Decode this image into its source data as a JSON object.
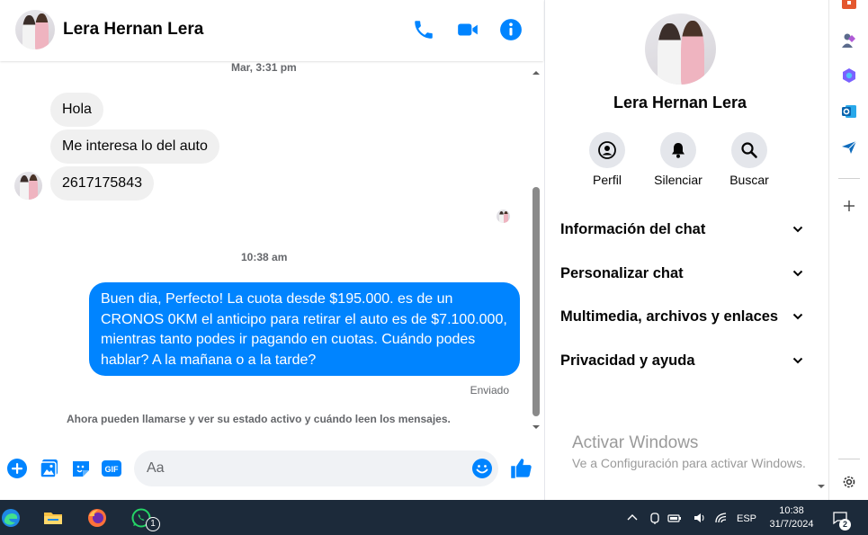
{
  "contact": {
    "name": "Lera Hernan Lera"
  },
  "conversation": {
    "timestamp_1": "Mar, 3:31 pm",
    "incoming": [
      "Hola",
      "Me interesa lo del auto",
      "2617175843"
    ],
    "timestamp_2": "10:38 am",
    "outgoing": "Buen dia, Perfecto! La cuota desde $195.000. es de un CRONOS 0KM el anticipo para retirar el auto es de $7.100.000, mientras tanto podes ir pagando en cuotas. Cuándo podes hablar? A la mañana o a la tarde?",
    "status": "Enviado",
    "system_note": "Ahora pueden llamarse y ver su estado activo y cuándo leen los mensajes."
  },
  "composer": {
    "placeholder": "Aa",
    "gif_label": "GIF"
  },
  "info_panel": {
    "actions": [
      {
        "label": "Perfil",
        "icon": "profile-icon"
      },
      {
        "label": "Silenciar",
        "icon": "bell-icon"
      },
      {
        "label": "Buscar",
        "icon": "search-icon"
      }
    ],
    "sections": [
      "Información del chat",
      "Personalizar chat",
      "Multimedia, archivos y enlaces",
      "Privacidad y ayuda"
    ]
  },
  "watermark": {
    "title": "Activar Windows",
    "subtitle": "Ve a Configuración para activar Windows."
  },
  "taskbar": {
    "whatsapp_badge": "1",
    "language": "ESP",
    "time": "10:38",
    "date": "31/7/2024",
    "notification_count": "2"
  },
  "colors": {
    "messenger_blue": "#0084ff",
    "bubble_grey": "#f0f0f0",
    "taskbar": "#1c2a3a"
  }
}
